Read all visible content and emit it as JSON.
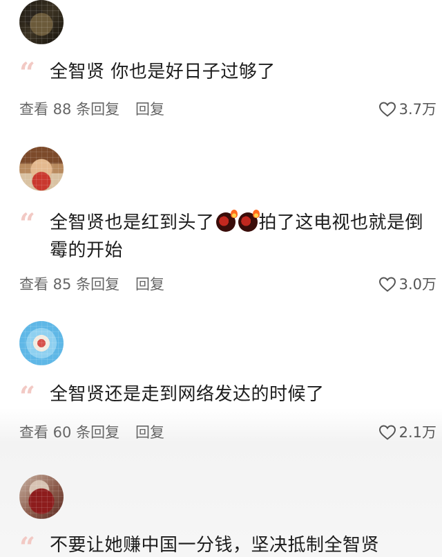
{
  "comments": [
    {
      "text_parts": [
        "全智贤 你也是好日子过够了"
      ],
      "replies_label": "查看 88 条回复",
      "reply_label": "回复",
      "likes": "3.7万"
    },
    {
      "text_parts": [
        "全智贤也是红到头了",
        "拍了这电视也就是倒霉的开始"
      ],
      "emojis": [
        "bomb-icon",
        "bomb-icon"
      ],
      "replies_label": "查看 85 条回复",
      "reply_label": "回复",
      "likes": "3.0万"
    },
    {
      "text_parts": [
        "全智贤还是走到网络发达的时候了"
      ],
      "replies_label": "查看 60 条回复",
      "reply_label": "回复",
      "likes": "2.1万"
    },
    {
      "text_parts": [
        "不要让她赚中国一分钱，坚决抵制全智贤"
      ]
    }
  ],
  "icons": {
    "quote": "quote-icon",
    "like": "heart-icon"
  },
  "colors": {
    "quote": "#f2c9c4",
    "meta_text": "#666666",
    "body_text": "#1c1c1c"
  }
}
